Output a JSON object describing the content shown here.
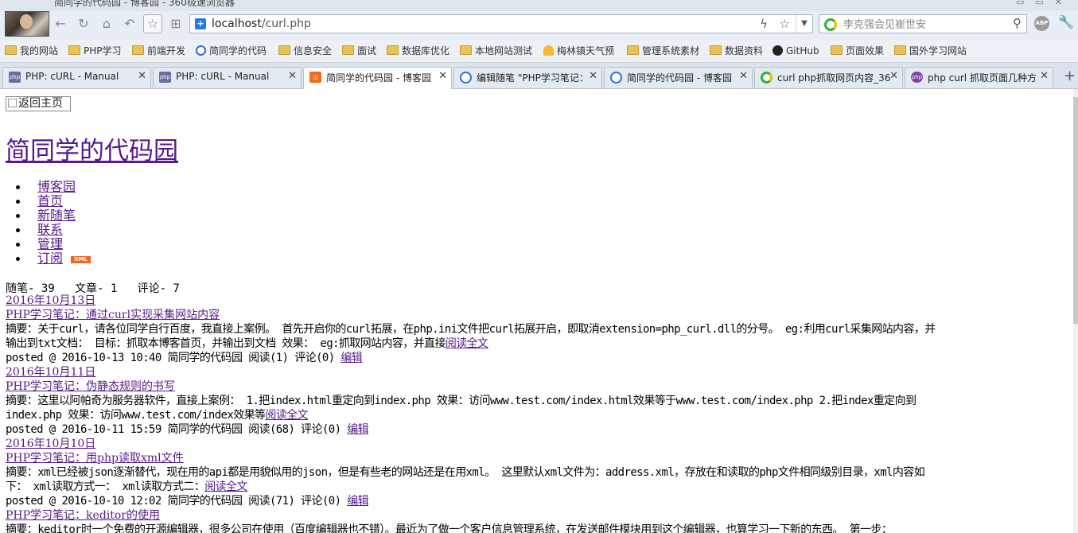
{
  "window": {
    "title": "简同学的代码园 - 博客园 - 360极速浏览器"
  },
  "nav": {
    "url_host": "localhost",
    "url_path": "/curl.php",
    "search_placeholder": "李克强会见崔世安",
    "abp_label": "ABP"
  },
  "bookmarks": [
    {
      "label": "我的网站",
      "icon": "folder-icon"
    },
    {
      "label": "PHP学习",
      "icon": "folder-icon"
    },
    {
      "label": "前端开发",
      "icon": "folder-icon"
    },
    {
      "label": "简同学的代码",
      "icon": "cnblogs-icon"
    },
    {
      "label": "信息安全",
      "icon": "folder-icon"
    },
    {
      "label": "面试",
      "icon": "folder-icon"
    },
    {
      "label": "数据库优化",
      "icon": "folder-icon"
    },
    {
      "label": "本地网站测试",
      "icon": "folder-icon"
    },
    {
      "label": "梅林镇天气预",
      "icon": "weather-icon"
    },
    {
      "label": "管理系统素材",
      "icon": "folder-icon"
    },
    {
      "label": "数据资料",
      "icon": "folder-icon"
    },
    {
      "label": "GitHub",
      "icon": "github-icon"
    },
    {
      "label": "页面效果",
      "icon": "folder-icon"
    },
    {
      "label": "国外学习网站",
      "icon": "folder-icon"
    }
  ],
  "tabs": [
    {
      "label": "PHP: cURL - Manual",
      "icon": "php-icon"
    },
    {
      "label": "PHP: cURL - Manual",
      "icon": "php-icon"
    },
    {
      "label": "简同学的代码园 - 博客园",
      "icon": "cnblogs-orange-icon",
      "active": true
    },
    {
      "label": "编辑随笔 \"PHP学习笔记：",
      "icon": "cnblogs-icon"
    },
    {
      "label": "简同学的代码园 - 博客园",
      "icon": "cnblogs-icon"
    },
    {
      "label": "curl php抓取网页内容_36",
      "icon": "360-search-icon"
    },
    {
      "label": "php curl 抓取页面几种方",
      "icon": "php-purple-icon"
    }
  ],
  "page": {
    "home_image_alt": "返回主页",
    "site_title": "简同学的代码园",
    "nav_links": [
      "博客园",
      "首页",
      "新随笔",
      "联系",
      "管理",
      "订阅"
    ],
    "xml_badge": "XML",
    "stats": "随笔- 39   文章- 1   评论- 7",
    "read_more": "阅读全文",
    "edit": "编辑",
    "posts": [
      {
        "date": "2016年10月13日",
        "title": "PHP学习笔记：通过curl实现采集网站内容",
        "summary_l1": "摘要：关于curl，请各位同学自行百度，我直接上案例。 首先开启你的curl拓展，在php.ini文件把curl拓展开启，即取消extension=php_curl.dll的分号。 eg:利用curl采集网站内容，并",
        "summary_l2": "输出到txt文档： 目标：抓取本博客首页，并输出到文档 效果： eg:抓取网站内容，并直接",
        "meta": "posted @ 2016-10-13 10:40 简同学的代码园 阅读(1) 评论(0) "
      },
      {
        "date": "2016年10月11日",
        "title": "PHP学习笔记：伪静态规则的书写",
        "summary_l1": "摘要：这里以阿帕奇为服务器软件，直接上案例： 1.把index.html重定向到index.php 效果：访问www.test.com/index.html效果等于www.test.com/index.php 2.把index重定向到",
        "summary_l2": "index.php 效果：访问www.test.com/index效果等",
        "meta": "posted @ 2016-10-11 15:59 简同学的代码园 阅读(68) 评论(0) "
      },
      {
        "date": "2016年10月10日",
        "title": "PHP学习笔记：用php读取xml文件",
        "summary_l1": "摘要：xml已经被json逐渐替代，现在用的api都是用貌似用的json，但是有些老的网站还是在用xml。 这里默认xml文件为：address.xml，存放在和读取的php文件相同级别目录，xml内容如",
        "summary_l2": "下： xml读取方式一： xml读取方式二：",
        "meta": "posted @ 2016-10-10 12:02 简同学的代码园 阅读(71) 评论(0) "
      },
      {
        "title": "PHP学习笔记：keditor的使用",
        "summary_l1": "摘要：keditor时一个免费的开源编辑器，很多公司在使用（百度编辑器也不错）。最近为了做一个客户信息管理系统，在发送邮件模块用到这个编辑器，也算学习一下新的东西。 第一步："
      }
    ]
  }
}
